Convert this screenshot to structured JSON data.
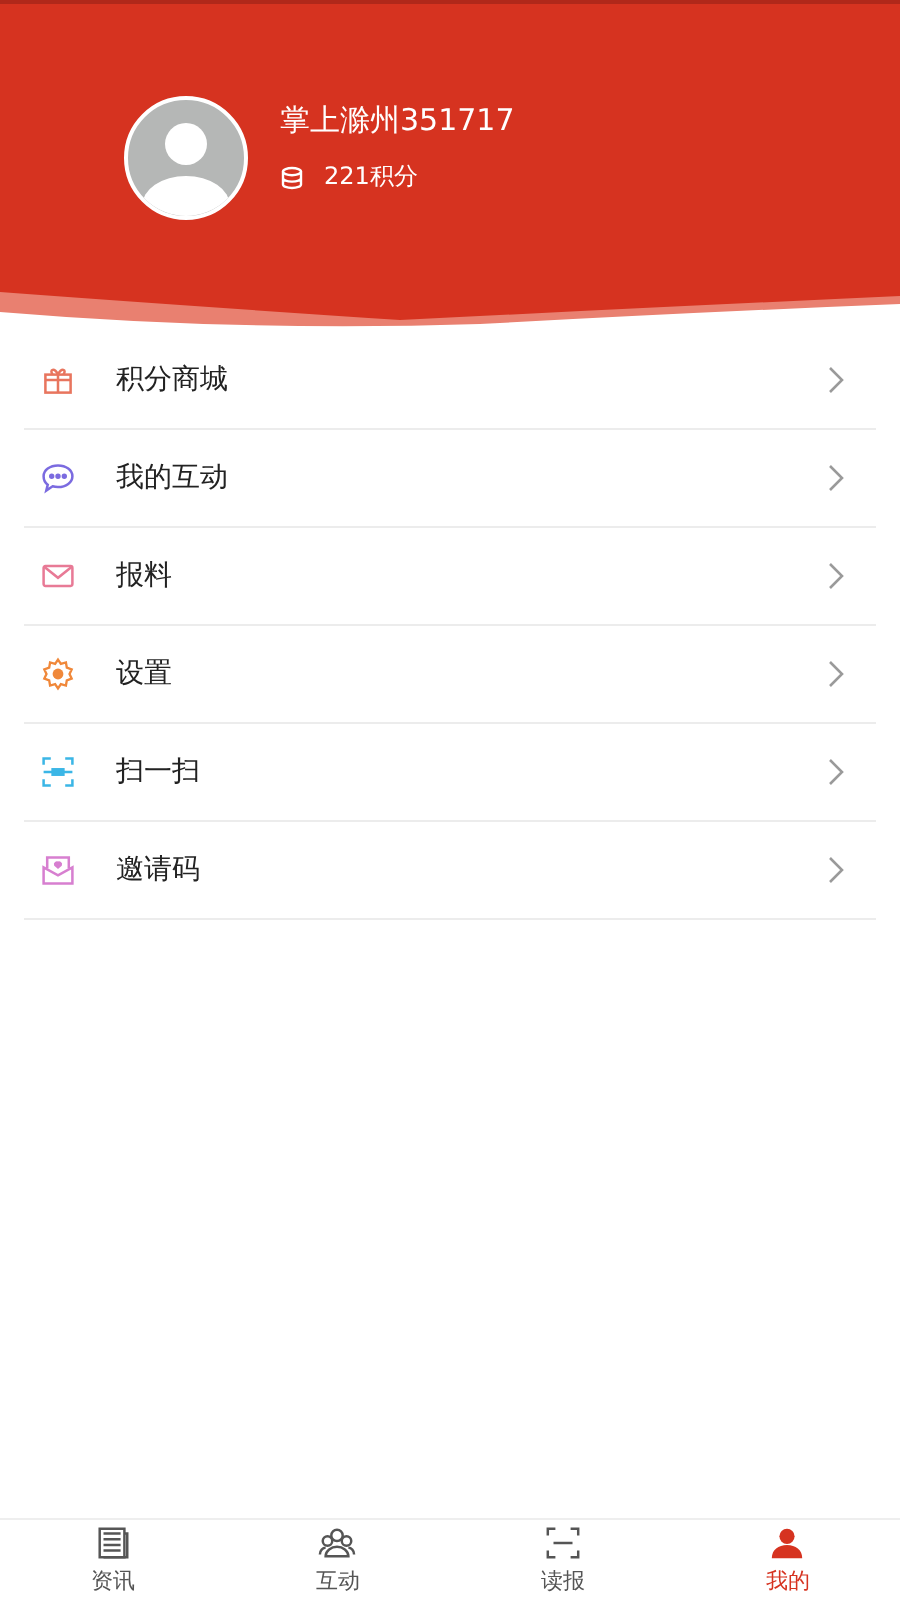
{
  "profile": {
    "name": "掌上滁州351717",
    "points": "221积分"
  },
  "menu": [
    {
      "kind": "gift",
      "label": "积分商城"
    },
    {
      "kind": "chat",
      "label": "我的互动"
    },
    {
      "kind": "mail",
      "label": "报料"
    },
    {
      "kind": "gear",
      "label": "设置"
    },
    {
      "kind": "scan",
      "label": "扫一扫"
    },
    {
      "kind": "invite",
      "label": "邀请码"
    }
  ],
  "tabs": [
    {
      "kind": "news",
      "label": "资讯",
      "selected": false
    },
    {
      "kind": "people",
      "label": "互动",
      "selected": false
    },
    {
      "kind": "scan",
      "label": "读报",
      "selected": false
    },
    {
      "kind": "person",
      "label": "我的",
      "selected": true
    }
  ]
}
